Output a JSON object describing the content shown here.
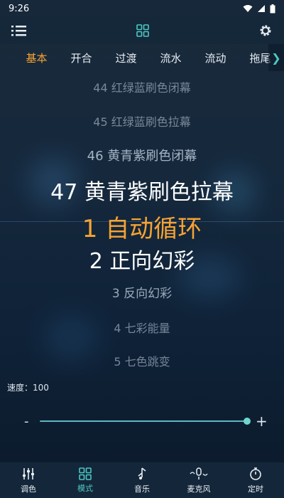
{
  "status": {
    "time": "9:26"
  },
  "tabs": [
    {
      "label": "基本",
      "active": true
    },
    {
      "label": "开合",
      "active": false
    },
    {
      "label": "过渡",
      "active": false
    },
    {
      "label": "流水",
      "active": false
    },
    {
      "label": "流动",
      "active": false
    },
    {
      "label": "拖尾",
      "active": false
    }
  ],
  "picker": {
    "items": [
      {
        "label": "44 红绿蓝刷色闭幕"
      },
      {
        "label": "45 红绿蓝刷色拉幕"
      },
      {
        "label": "46 黄青紫刷色闭幕"
      },
      {
        "label": "47 黄青紫刷色拉幕"
      },
      {
        "label": "1 自动循环",
        "selected": true
      },
      {
        "label": "2 正向幻彩"
      },
      {
        "label": "3 反向幻彩"
      },
      {
        "label": "4 七彩能量"
      },
      {
        "label": "5 七色跳变"
      }
    ]
  },
  "speed": {
    "label": "速度：100",
    "value": 100,
    "max": 100,
    "minus": "-",
    "plus": "+"
  },
  "bottom_nav": [
    {
      "label": "调色",
      "icon": "equalizer-icon",
      "active": false
    },
    {
      "label": "模式",
      "icon": "grid-icon",
      "active": true
    },
    {
      "label": "音乐",
      "icon": "music-note-icon",
      "active": false
    },
    {
      "label": "麦克风",
      "icon": "microphone-icon",
      "active": false
    },
    {
      "label": "定时",
      "icon": "timer-icon",
      "active": false
    }
  ],
  "colors": {
    "accent": "#4cc7c3",
    "selected": "#f7a233",
    "background": "#15283c"
  }
}
